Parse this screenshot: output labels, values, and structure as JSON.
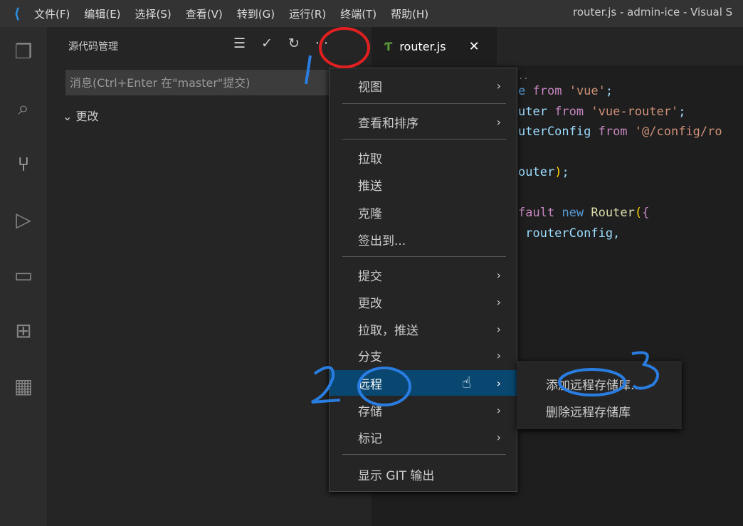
{
  "titlebar": {
    "menus": [
      "文件(F)",
      "编辑(E)",
      "选择(S)",
      "查看(V)",
      "转到(G)",
      "运行(R)",
      "终端(T)",
      "帮助(H)"
    ],
    "window_title": "router.js - admin-ice - Visual S"
  },
  "sidebar": {
    "title": "源代码管理",
    "commit_placeholder": "消息(Ctrl+Enter 在\"master\"提交)",
    "changes_label": "更改"
  },
  "tab": {
    "label": "router.js",
    "close": "✕"
  },
  "code_lines": [
    "e from 'vue';",
    "uter from 'vue-router';",
    "uterConfig from '@/config/ro",
    "",
    "outer);",
    "",
    "fault new Router({",
    " routerConfig,"
  ],
  "context_menu": {
    "items": [
      "视图",
      "查看和排序",
      "拉取",
      "推送",
      "克隆",
      "签出到...",
      "提交",
      "更改",
      "拉取，推送",
      "分支",
      "远程",
      "存储",
      "标记",
      "显示 GIT 输出"
    ],
    "highlighted": "远程"
  },
  "submenu": {
    "items": [
      "添加远程存储库...",
      "删除远程存储库"
    ]
  },
  "annotations": {
    "labels": [
      "1",
      "2",
      "3"
    ],
    "circle_color": "#e02020",
    "pen_color": "#2a7de0"
  }
}
